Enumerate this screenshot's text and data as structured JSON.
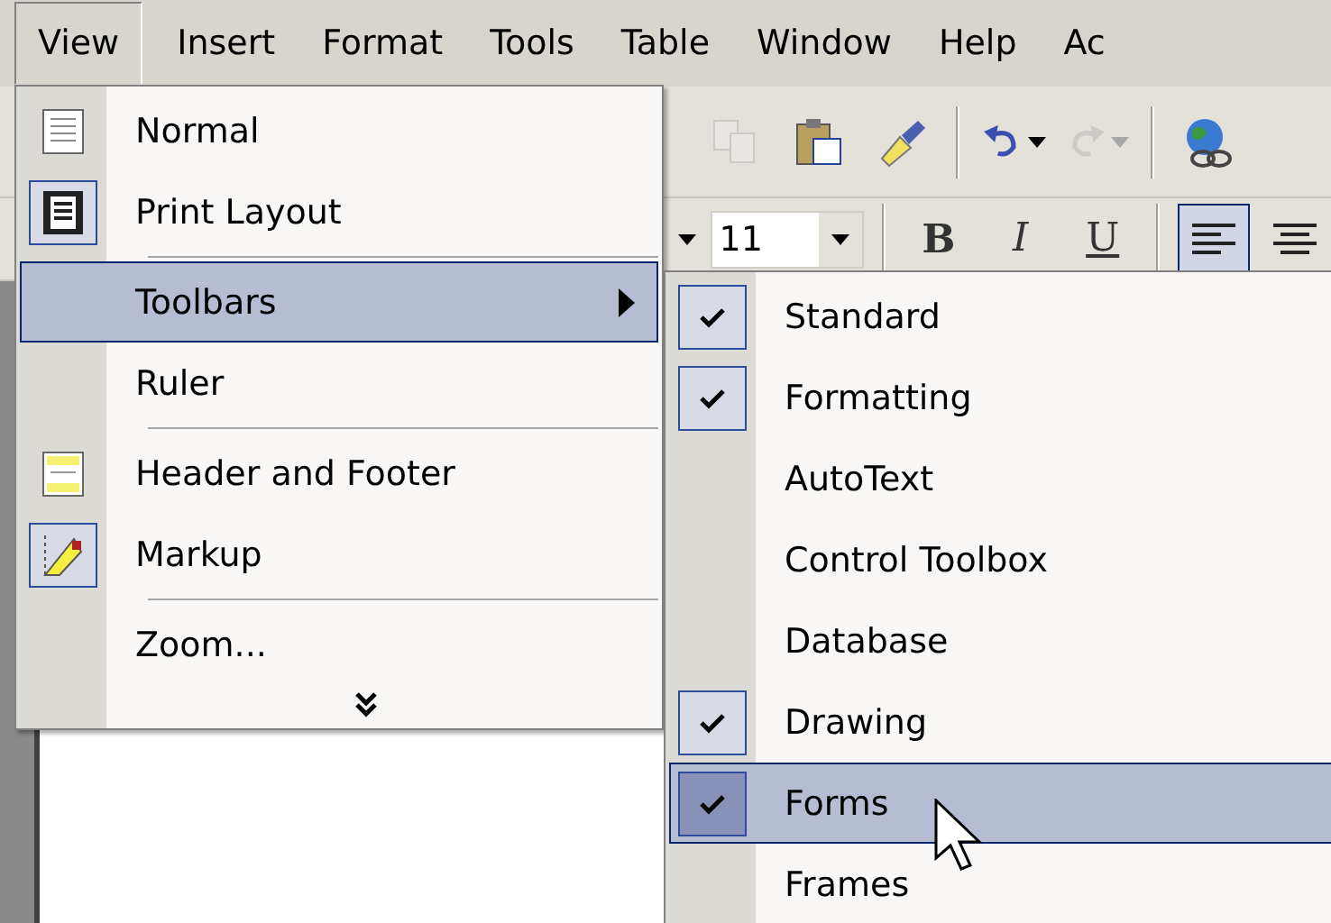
{
  "menu_bar": [
    {
      "label": "View",
      "selected": true
    },
    {
      "label": "Insert",
      "selected": false
    },
    {
      "label": "Format",
      "selected": false
    },
    {
      "label": "Tools",
      "selected": false
    },
    {
      "label": "Table",
      "selected": false
    },
    {
      "label": "Window",
      "selected": false
    },
    {
      "label": "Help",
      "selected": false
    },
    {
      "label": "Ac",
      "selected": false
    }
  ],
  "standard_toolbar": [
    {
      "kind": "copy",
      "disabled": true
    },
    {
      "kind": "paste",
      "disabled": false
    },
    {
      "kind": "brush",
      "disabled": false
    },
    {
      "kind": "separator"
    },
    {
      "kind": "undo",
      "disabled": false
    },
    {
      "kind": "redo",
      "disabled": true
    },
    {
      "kind": "separator"
    },
    {
      "kind": "globe",
      "disabled": false
    }
  ],
  "formatting_toolbar": {
    "font_size": "11",
    "styles": [
      {
        "label": "B",
        "kind": "bold"
      },
      {
        "label": "I",
        "kind": "italic"
      },
      {
        "label": "U",
        "kind": "underline"
      }
    ],
    "alignment": [
      {
        "kind": "left",
        "pressed": true
      },
      {
        "kind": "center",
        "pressed": false
      }
    ]
  },
  "view_menu": {
    "items": [
      {
        "kind": "item",
        "label": "Normal",
        "checked": false,
        "selected": false
      },
      {
        "kind": "item",
        "label": "Print Layout",
        "checked": true,
        "selected": false
      },
      {
        "kind": "separator"
      },
      {
        "kind": "item",
        "label": "Toolbars",
        "submenu": true,
        "selected": true
      },
      {
        "kind": "item",
        "label": "Ruler",
        "selected": false
      },
      {
        "kind": "separator"
      },
      {
        "kind": "item",
        "label": "Header and Footer",
        "checked": false,
        "selected": false
      },
      {
        "kind": "item",
        "label": "Markup",
        "checked": true,
        "selected": false
      },
      {
        "kind": "separator"
      },
      {
        "kind": "item",
        "label": "Zoom...",
        "selected": false
      },
      {
        "kind": "more"
      }
    ]
  },
  "toolbars_submenu": {
    "items": [
      {
        "label": "Standard",
        "checked": true,
        "selected": false
      },
      {
        "label": "Formatting",
        "checked": true,
        "selected": false
      },
      {
        "label": "AutoText",
        "checked": false,
        "selected": false
      },
      {
        "label": "Control Toolbox",
        "checked": false,
        "selected": false
      },
      {
        "label": "Database",
        "checked": false,
        "selected": false
      },
      {
        "label": "Drawing",
        "checked": true,
        "selected": false
      },
      {
        "label": "Forms",
        "checked": true,
        "selected": true
      },
      {
        "label": "Frames",
        "checked": false,
        "selected": false
      }
    ]
  }
}
